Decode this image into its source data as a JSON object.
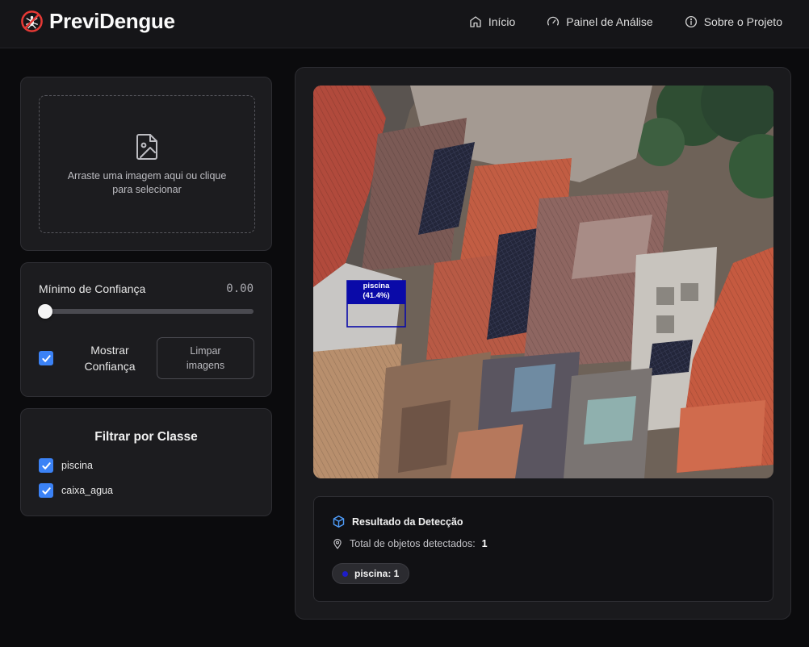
{
  "app": {
    "name": "PreviDengue"
  },
  "nav": {
    "items": [
      {
        "label": "Início",
        "icon": "home-icon"
      },
      {
        "label": "Painel de Análise",
        "icon": "gauge-icon"
      },
      {
        "label": "Sobre o Projeto",
        "icon": "info-icon"
      }
    ]
  },
  "upload": {
    "text": "Arraste uma imagem aqui ou clique para selecionar",
    "icon": "image-file-icon"
  },
  "confidence": {
    "label": "Mínimo de Confiança",
    "value": "0.00",
    "slider_fraction": 0.0,
    "show_label": "Mostrar Confiança",
    "show_checked": true,
    "clear_button": "Limpar imagens"
  },
  "filter": {
    "title": "Filtrar por Classe",
    "classes": [
      {
        "label": "piscina",
        "checked": true
      },
      {
        "label": "caixa_agua",
        "checked": true
      }
    ]
  },
  "detection_box": {
    "label": "piscina",
    "confidence": "(41.4%)",
    "color": "#0a0aa8"
  },
  "result": {
    "title": "Resultado da Detecção",
    "total_label": "Total de objetos detectados:",
    "total_value": "1",
    "chip_label": "piscina: 1",
    "chip_color": "#1d1dc9"
  },
  "colors": {
    "accent": "#3b82f6",
    "background": "#0b0b0d",
    "card": "#1c1c1f"
  }
}
